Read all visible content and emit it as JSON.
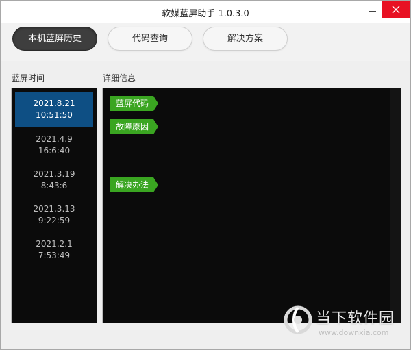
{
  "window": {
    "title": "软媒蓝屏助手 1.0.3.0"
  },
  "tabs": [
    {
      "label": "本机蓝屏历史",
      "active": true
    },
    {
      "label": "代码查询",
      "active": false
    },
    {
      "label": "解决方案",
      "active": false
    }
  ],
  "left": {
    "label": "蓝屏时间",
    "items": [
      {
        "date": "2021.8.21",
        "time": "10:51:50",
        "selected": true
      },
      {
        "date": "2021.4.9",
        "time": "16:6:40",
        "selected": false
      },
      {
        "date": "2021.3.19",
        "time": "8:43:6",
        "selected": false
      },
      {
        "date": "2021.3.13",
        "time": "9:22:59",
        "selected": false
      },
      {
        "date": "2021.2.1",
        "time": "7:53:49",
        "selected": false
      }
    ]
  },
  "right": {
    "label": "详细信息",
    "tags": [
      {
        "label": "蓝屏代码"
      },
      {
        "label": "故障原因"
      },
      {
        "label": "解决办法"
      }
    ]
  },
  "watermark": {
    "text": "当下软件园",
    "url": "www.downxia.com"
  },
  "colors": {
    "selected": "#0e4f84",
    "tag": "#3aa521",
    "close": "#e81123"
  },
  "icons": {
    "close": "close-icon",
    "minimize": "minimize-icon",
    "logo": "watermark-logo-icon"
  }
}
